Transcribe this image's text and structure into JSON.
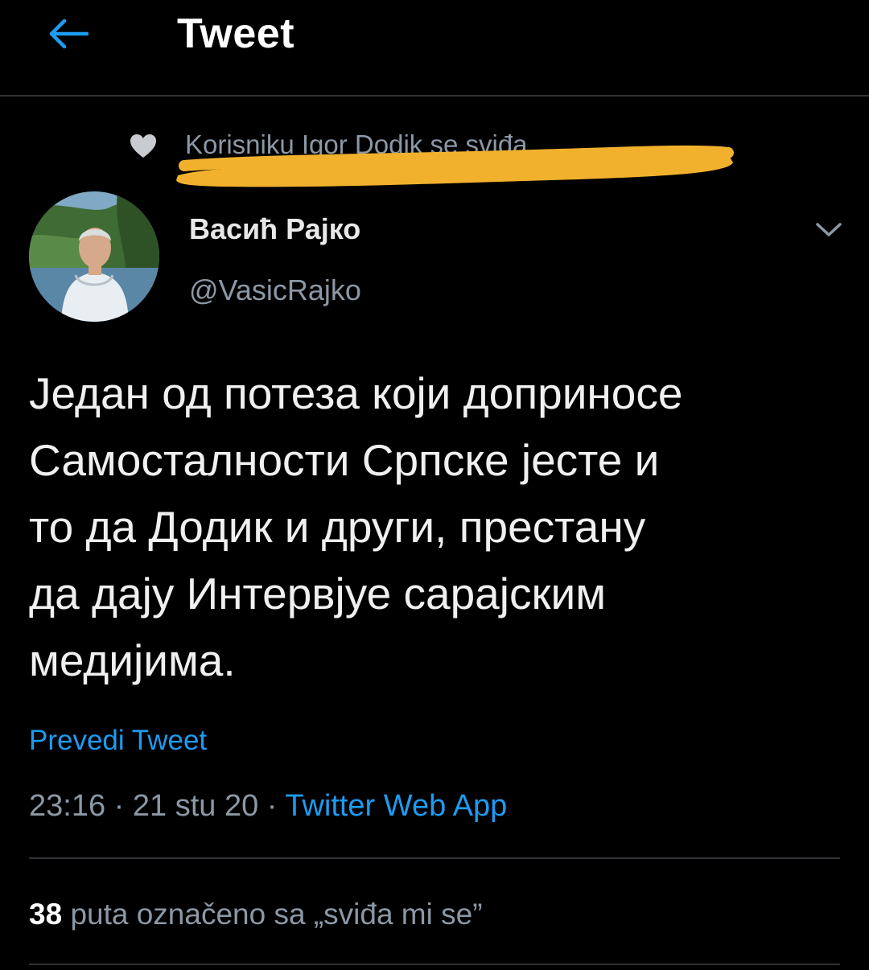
{
  "header": {
    "title": "Tweet",
    "back_icon": "arrow-left-icon"
  },
  "social_context": {
    "icon": "heart-icon",
    "text": "Korisniku Igor Dodik se sviđa",
    "highlight_color": "#f1b12d"
  },
  "author": {
    "display_name": "Васић Рајко",
    "handle": "@VasicRajko"
  },
  "tweet": {
    "lines": [
      "Један од потеза који доприносе",
      "Самосталности Српске јесте и",
      "то да Додик и други, престану",
      "да дају Интервјуе сарајским",
      "медијима."
    ],
    "translate_label": "Prevedi Tweet",
    "time": "23:16",
    "date": "21 stu 20",
    "separator": "·",
    "source": "Twitter Web App"
  },
  "likes": {
    "count": "38",
    "label": "puta označeno sa „sviđa mi se”"
  },
  "colors": {
    "background": "#000000",
    "accent": "#1d9bf0",
    "muted": "#8b98a5",
    "divider": "#2f3336"
  }
}
